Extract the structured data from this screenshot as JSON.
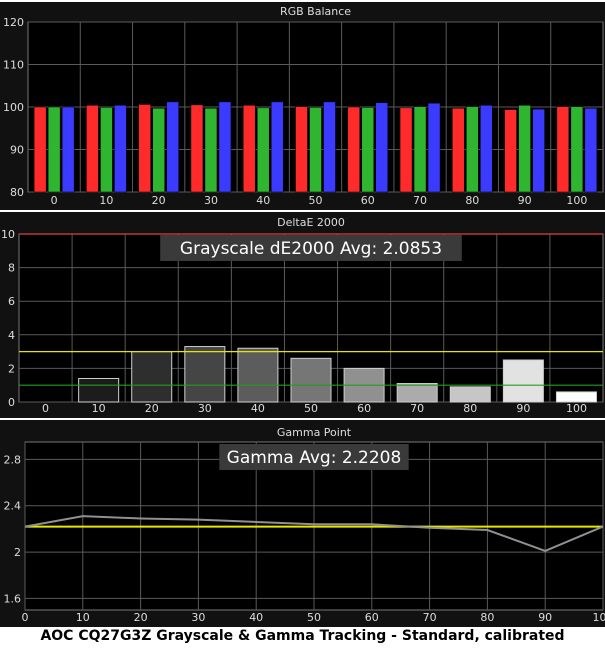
{
  "caption": "AOC CQ27G3Z Grayscale & Gamma Tracking - Standard, calibrated",
  "colors": {
    "panel_bg": "#111111",
    "plot_bg": "#000000",
    "grid": "#5a5a5a",
    "text": "#dddddd",
    "red": "#ff2a2a",
    "green": "#2fb52f",
    "blue": "#3b3bff",
    "yellow": "#e6e600",
    "green_line": "#1f9e1f",
    "red_line": "#e04040",
    "gamma_line": "#909090"
  },
  "chart_data": [
    {
      "type": "bar",
      "title": "RGB Balance",
      "categories": [
        "0",
        "10",
        "20",
        "30",
        "40",
        "50",
        "60",
        "70",
        "80",
        "90",
        "100"
      ],
      "ylim": [
        80,
        120
      ],
      "yticks": [
        80,
        90,
        100,
        110,
        120
      ],
      "grid": true,
      "series": [
        {
          "color": "red",
          "values": [
            100,
            100.4,
            100.6,
            100.5,
            100.4,
            100.1,
            100,
            99.8,
            99.7,
            99.4,
            100.1
          ]
        },
        {
          "color": "green",
          "values": [
            100,
            99.9,
            99.7,
            99.7,
            99.8,
            99.9,
            99.9,
            100.1,
            100.1,
            100.4,
            100.1
          ]
        },
        {
          "color": "blue",
          "values": [
            100,
            100.4,
            101.2,
            101.2,
            101.2,
            101.2,
            101,
            100.9,
            100.4,
            99.5,
            99.7
          ]
        }
      ]
    },
    {
      "type": "bar",
      "title": "DeltaE 2000",
      "annotation": "Grayscale dE2000 Avg: 2.0853",
      "categories": [
        "0",
        "10",
        "20",
        "30",
        "40",
        "50",
        "60",
        "70",
        "80",
        "90",
        "100"
      ],
      "ylim": [
        0,
        10
      ],
      "yticks": [
        0,
        2,
        4,
        6,
        8,
        10
      ],
      "grid": true,
      "values": [
        0,
        1.4,
        3.0,
        3.3,
        3.2,
        2.6,
        2.0,
        1.1,
        0.9,
        2.5,
        0.6
      ],
      "bar_shades": [
        "#000000",
        "#1c1c1c",
        "#2e2e2e",
        "#454545",
        "#5c5c5c",
        "#767676",
        "#909090",
        "#ababab",
        "#c6c6c6",
        "#e2e2e2",
        "#ffffff"
      ],
      "reference_lines": [
        {
          "value": 10,
          "color": "red_line"
        },
        {
          "value": 3,
          "color": "yellow"
        },
        {
          "value": 1,
          "color": "green_line"
        }
      ]
    },
    {
      "type": "line",
      "title": "Gamma Point",
      "annotation": "Gamma Avg: 2.2208",
      "x": [
        0,
        10,
        20,
        30,
        40,
        50,
        60,
        70,
        80,
        90,
        100
      ],
      "y": [
        2.22,
        2.31,
        2.29,
        2.28,
        2.26,
        2.24,
        2.24,
        2.21,
        2.19,
        2.01,
        2.22
      ],
      "xticks": [
        0,
        10,
        20,
        30,
        40,
        50,
        60,
        70,
        80,
        90,
        100
      ],
      "ylim": [
        1.5,
        2.95
      ],
      "yticks": [
        1.6,
        2,
        2.4,
        2.8
      ],
      "target": 2.22,
      "grid": true
    }
  ]
}
